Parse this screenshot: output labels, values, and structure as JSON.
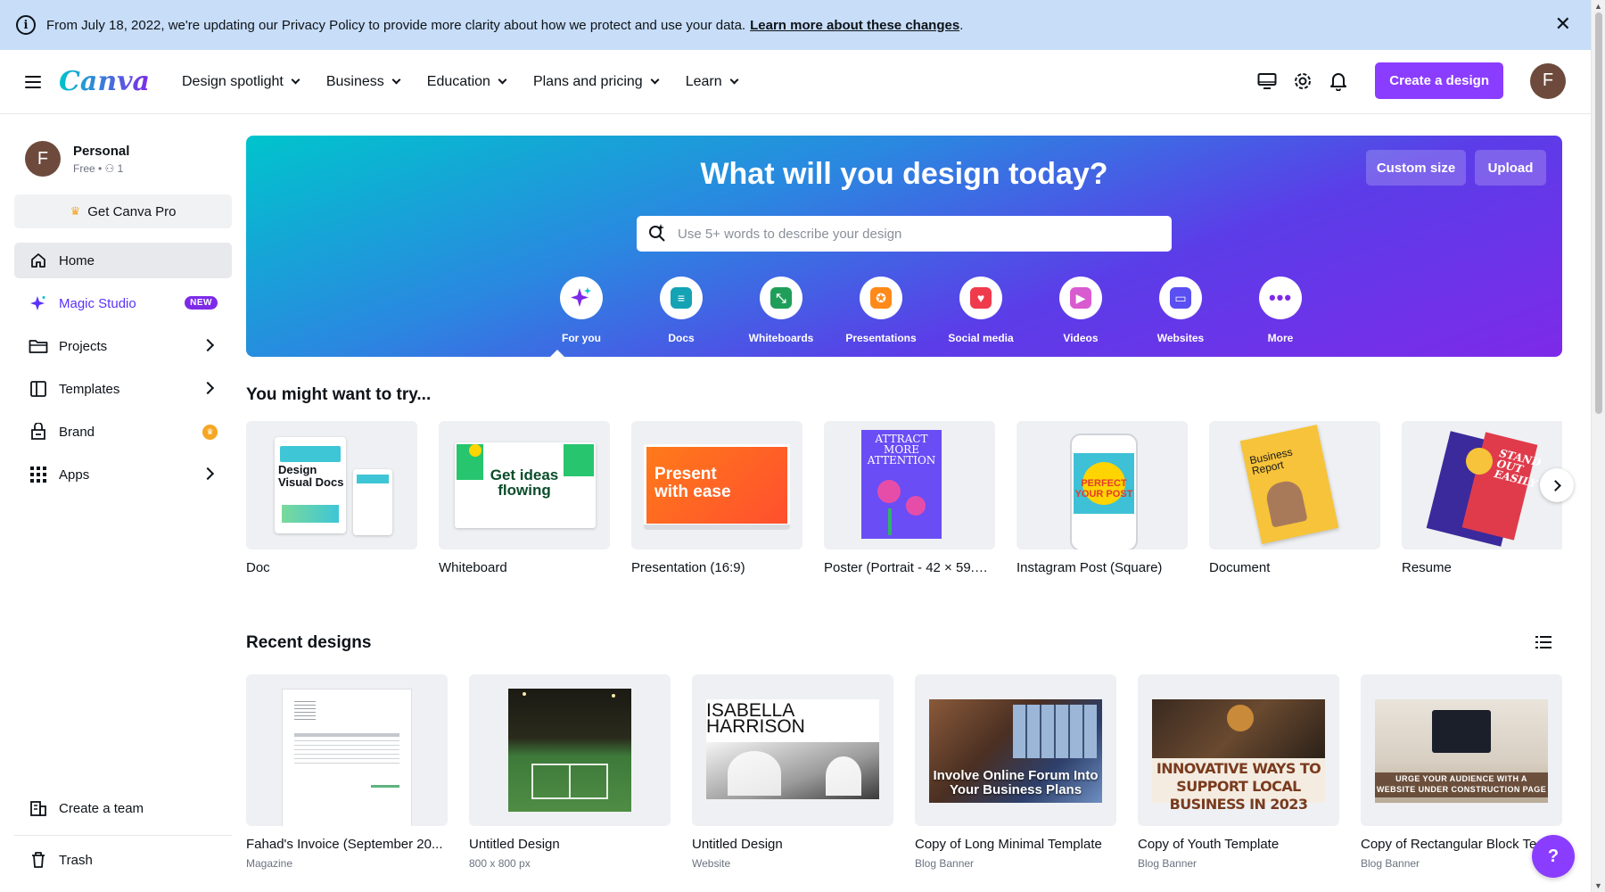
{
  "banner": {
    "text": "From July 18, 2022, we're updating our Privacy Policy to provide more clarity about how we protect and use your data.",
    "link": "Learn more about these changes",
    "period": "."
  },
  "nav": {
    "logo": "Canva",
    "menu": [
      "Design spotlight",
      "Business",
      "Education",
      "Plans and pricing",
      "Learn"
    ],
    "create_button": "Create a design",
    "avatar_initial": "F"
  },
  "sidebar": {
    "account_name": "Personal",
    "account_plan": "Free • ⚇ 1",
    "avatar_initial": "F",
    "get_pro": "Get Canva Pro",
    "items": [
      {
        "label": "Home"
      },
      {
        "label": "Magic Studio",
        "badge": "NEW"
      },
      {
        "label": "Projects"
      },
      {
        "label": "Templates"
      },
      {
        "label": "Brand"
      },
      {
        "label": "Apps"
      }
    ],
    "create_team": "Create a team",
    "trash": "Trash"
  },
  "hero": {
    "title": "What will you design today?",
    "custom_size": "Custom size",
    "upload": "Upload",
    "search_placeholder": "Use 5+ words to describe your design",
    "categories": [
      {
        "label": "For you",
        "color": "#7d2ae8"
      },
      {
        "label": "Docs",
        "color": "#13a3b5"
      },
      {
        "label": "Whiteboards",
        "color": "#1f9e5a"
      },
      {
        "label": "Presentations",
        "color": "#ff8a1a"
      },
      {
        "label": "Social media",
        "color": "#ef3b4c"
      },
      {
        "label": "Videos",
        "color": "#d95bd0"
      },
      {
        "label": "Websites",
        "color": "#5a4ff0"
      },
      {
        "label": "More",
        "color": "#7d2ae8"
      }
    ]
  },
  "try_section": {
    "title": "You might want to try...",
    "items": [
      {
        "label": "Doc"
      },
      {
        "label": "Whiteboard"
      },
      {
        "label": "Presentation (16:9)"
      },
      {
        "label": "Poster (Portrait - 42 × 59.4 ..."
      },
      {
        "label": "Instagram Post (Square)"
      },
      {
        "label": "Document"
      },
      {
        "label": "Resume"
      }
    ],
    "thumb_text": {
      "doc_title": "Design Visual Docs",
      "whiteboard": "Get ideas flowing",
      "presentation": "Present with ease",
      "poster": "ATTRACT MORE ATTENTION",
      "instagram": "PERFECT YOUR POST",
      "document": "Business Report",
      "resume": "STAND OUT EASILY"
    }
  },
  "recent": {
    "title": "Recent designs",
    "items": [
      {
        "label": "Fahad's Invoice (September 20...",
        "type": "Magazine"
      },
      {
        "label": "Untitled Design",
        "type": "800 x 800 px"
      },
      {
        "label": "Untitled Design",
        "type": "Website"
      },
      {
        "label": "Copy of Long Minimal Template",
        "type": "Blog Banner"
      },
      {
        "label": "Copy of Youth Template",
        "type": "Blog Banner"
      },
      {
        "label": "Copy of Rectangular Block Te",
        "type": "Blog Banner"
      }
    ],
    "thumb_text": {
      "isabella": "ISABELLA HARRISON",
      "forum": "Involve Online Forum Into Your Business Plans",
      "youth": "INNOVATIVE WAYS TO SUPPORT LOCAL BUSINESS IN 2023",
      "block": "URGE YOUR AUDIENCE WITH A WEBSITE UNDER CONSTRUCTION PAGE"
    }
  },
  "help_label": "?"
}
